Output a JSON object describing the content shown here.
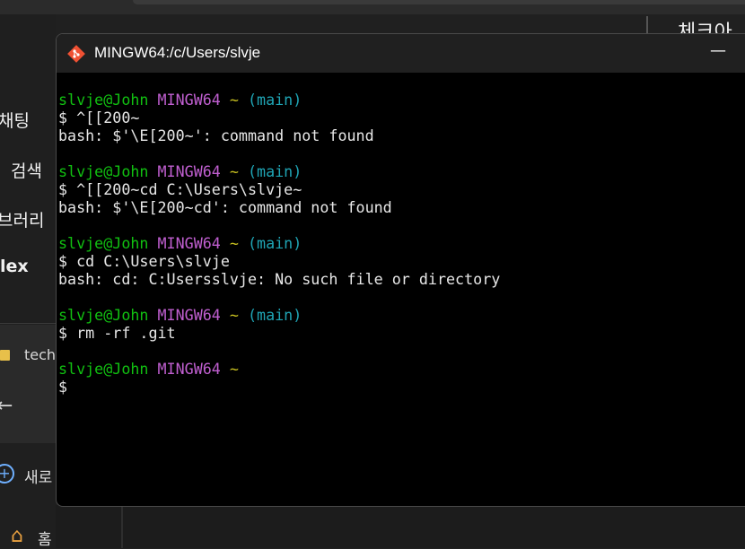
{
  "sidebar": {
    "items": [
      "채팅",
      "검색",
      "브러리",
      "lex"
    ],
    "folder_label": "tech",
    "back_glyph": "←",
    "new_label": "새로",
    "home_label": "홈"
  },
  "right_panel": {
    "title": "체크아"
  },
  "terminal": {
    "title": "MINGW64:/c/Users/slvje",
    "minimize_glyph": "—",
    "prompt": {
      "user": "slvje@John",
      "host": "MINGW64",
      "cwd": "~",
      "branch": "(main)"
    },
    "lines": [
      {
        "kind": "prompt",
        "branch": true
      },
      {
        "kind": "cmd",
        "text": "$ ^[[200~"
      },
      {
        "kind": "out",
        "text": "bash: $'\\E[200~': command not found"
      },
      {
        "kind": "blank"
      },
      {
        "kind": "prompt",
        "branch": true
      },
      {
        "kind": "cmd",
        "text": "$ ^[[200~cd C:\\Users\\slvje~"
      },
      {
        "kind": "out",
        "text": "bash: $'\\E[200~cd': command not found"
      },
      {
        "kind": "blank"
      },
      {
        "kind": "prompt",
        "branch": true
      },
      {
        "kind": "cmd",
        "text": "$ cd C:\\Users\\slvje"
      },
      {
        "kind": "out",
        "text": "bash: cd: C:Usersslvje: No such file or directory"
      },
      {
        "kind": "blank"
      },
      {
        "kind": "prompt",
        "branch": true
      },
      {
        "kind": "cmd",
        "text": "$ rm -rf .git"
      },
      {
        "kind": "blank"
      },
      {
        "kind": "prompt",
        "branch": false
      },
      {
        "kind": "cmd",
        "text": "$"
      }
    ]
  }
}
